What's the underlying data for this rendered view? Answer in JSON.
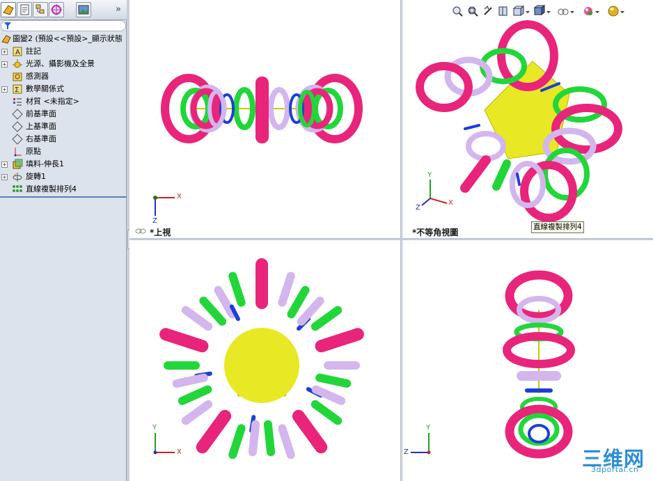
{
  "panel": {
    "tabs": [
      "feature-manager-tab",
      "property-manager-tab",
      "configuration-manager-tab",
      "dimxpert-tab",
      "display-manager-tab"
    ],
    "more": "»",
    "root": "圖變2 (預設<<預設>_顯示狀態",
    "items": [
      {
        "label": "註記",
        "icon": "annotations-icon",
        "expandable": true
      },
      {
        "label": "光源、攝影機及全景",
        "icon": "lights-cameras-icon",
        "expandable": true
      },
      {
        "label": "感測器",
        "icon": "sensors-icon",
        "expandable": false
      },
      {
        "label": "數學關係式",
        "icon": "equations-icon",
        "expandable": true
      },
      {
        "label": "材質 <未指定>",
        "icon": "material-icon",
        "expandable": false
      },
      {
        "label": "前基準面",
        "icon": "plane-icon",
        "expandable": false
      },
      {
        "label": "上基準面",
        "icon": "plane-icon",
        "expandable": false
      },
      {
        "label": "右基準面",
        "icon": "plane-icon",
        "expandable": false
      },
      {
        "label": "原點",
        "icon": "origin-icon",
        "expandable": false
      },
      {
        "label": "填料-伸長1",
        "icon": "extrude-icon",
        "expandable": true
      },
      {
        "label": "旋轉1",
        "icon": "revolve-icon",
        "expandable": true
      },
      {
        "label": "直線複製排列4",
        "icon": "linear-pattern-icon",
        "expandable": false
      }
    ]
  },
  "viewports": {
    "top_left": {
      "label": "*上視",
      "axes": [
        "X",
        "Z"
      ]
    },
    "top_right": {
      "label": "*不等角視圖",
      "axes": [
        "X",
        "Y",
        "Z"
      ]
    },
    "bottom_left": {
      "label": "",
      "axes": [
        "X",
        "Y"
      ]
    },
    "bottom_right": {
      "label": "",
      "axes": [
        "Y",
        "Z"
      ]
    }
  },
  "tooltip": "直線複製排列4",
  "heads_up_toolbar": [
    "zoom-to-fit-icon",
    "zoom-to-area-icon",
    "previous-view-icon",
    "section-view-icon",
    "view-orientation-icon",
    "display-style-icon",
    "hide-show-items-icon",
    "edit-appearance-icon",
    "apply-scene-icon"
  ],
  "colors": {
    "magenta": "#e8257a",
    "green": "#22d63a",
    "lavender": "#d3b6ee",
    "blue": "#1c3fd8",
    "yellow": "#e8e825"
  },
  "watermark": {
    "cn": "三维网",
    "en": "3dportal.cn"
  }
}
